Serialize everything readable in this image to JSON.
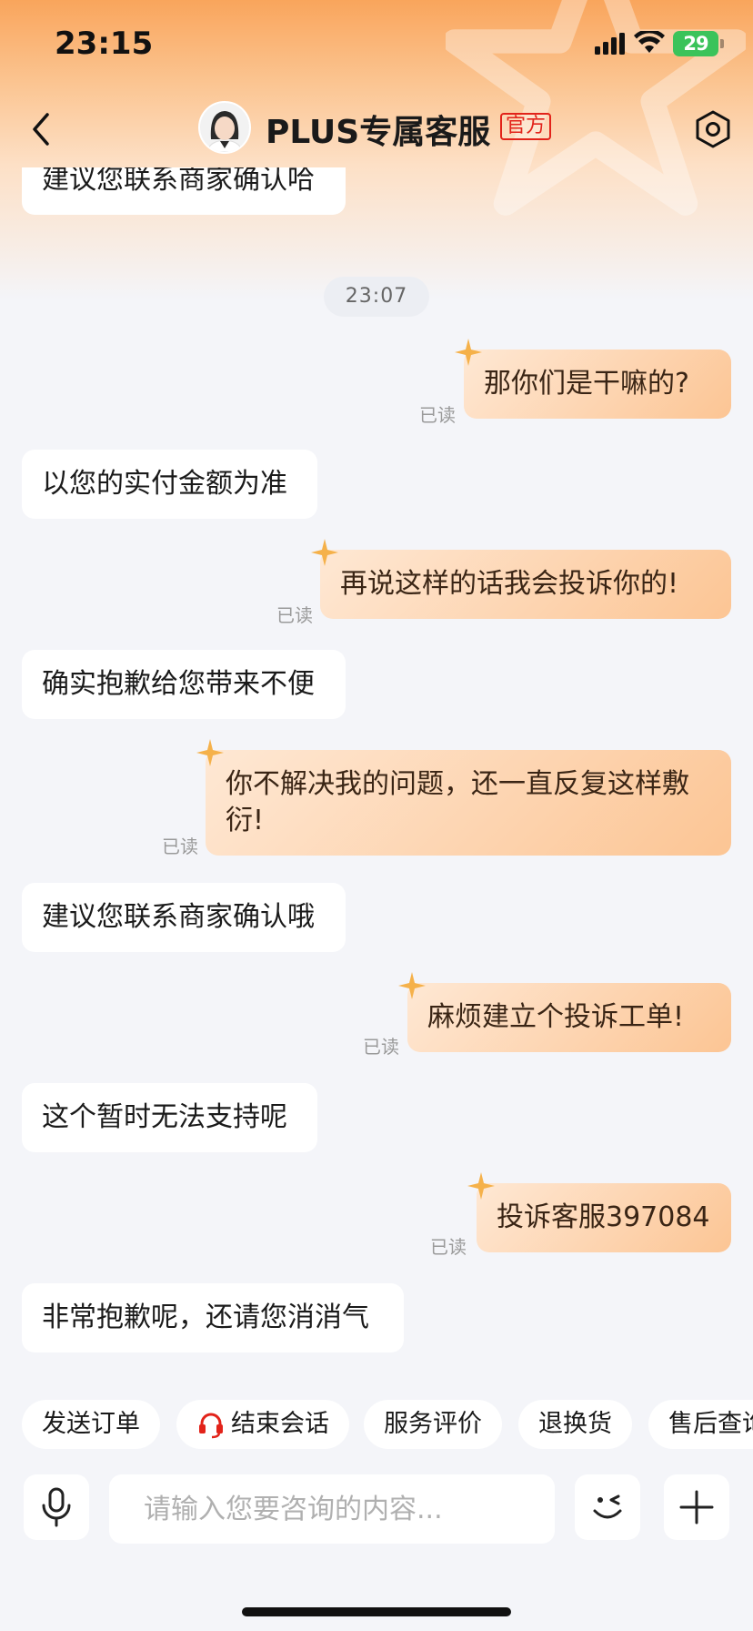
{
  "status_bar": {
    "time": "23:15",
    "battery": "29"
  },
  "header": {
    "title": "PLUS专属客服",
    "badge": "官方"
  },
  "messages": {
    "m0": "建议您联系商家确认哈",
    "sep": "23:07",
    "m1": "那你们是干嘛的?",
    "m2": "以您的实付金额为准",
    "m3": "再说这样的话我会投诉你的!",
    "m4": "确实抱歉给您带来不便",
    "m5a": "你不解决我的问题，还一直反复这样敷",
    "m5b": "衍!",
    "m6": "建议您联系商家确认哦",
    "m7": "麻烦建立个投诉工单!",
    "m8": "这个暂时无法支持呢",
    "m9": "投诉客服397084",
    "m10": "非常抱歉呢，还请您消消气",
    "read_label": "已读"
  },
  "quick_actions": [
    "发送订单",
    "结束会话",
    "服务评价",
    "退换货",
    "售后查询"
  ],
  "input": {
    "placeholder": "请输入您要咨询的内容..."
  },
  "colors": {
    "accent_orange": "#f9a55c",
    "official_red": "#e2231a",
    "bubble_right": "#fdd3ae",
    "battery_green": "#3bc35a"
  },
  "icons": {
    "back": "back-icon",
    "settings": "settings-icon",
    "mic": "mic-icon",
    "emoji": "emoji-icon",
    "plus": "plus-icon",
    "headset": "headset-icon"
  }
}
